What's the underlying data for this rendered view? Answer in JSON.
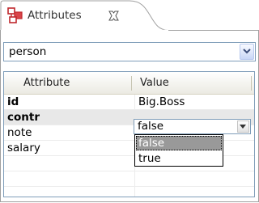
{
  "view": {
    "tab_title": "Attributes",
    "tab_icon": "attributes-icon",
    "close_icon": "close-icon"
  },
  "combo": {
    "value": "person",
    "arrow_icon": "chevron-down-icon"
  },
  "table": {
    "columns": [
      "Attribute",
      "Value"
    ],
    "rows": [
      {
        "attribute": "id",
        "value": "Big.Boss",
        "bold": true
      },
      {
        "attribute": "contr",
        "value": "false",
        "bold": true,
        "editing": true
      },
      {
        "attribute": "note",
        "value": "",
        "bold": false
      },
      {
        "attribute": "salary",
        "value": "",
        "bold": false
      }
    ]
  },
  "editor": {
    "value": "false",
    "options": [
      "false",
      "true"
    ],
    "highlighted": "false"
  }
}
